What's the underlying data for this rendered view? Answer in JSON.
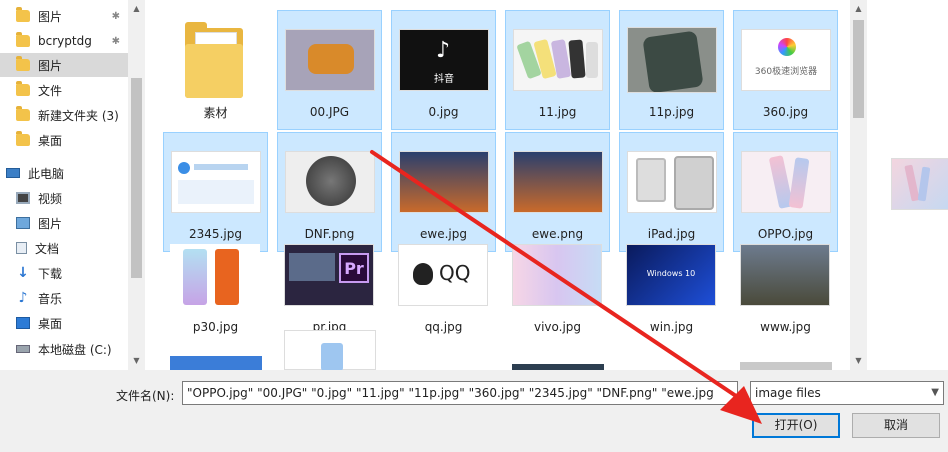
{
  "sidebar": {
    "items": [
      {
        "label": "图片",
        "pinned": true,
        "icon": "folder-icon"
      },
      {
        "label": "bcryptdg",
        "pinned": true,
        "icon": "folder-icon"
      },
      {
        "label": "图片",
        "pinned": false,
        "icon": "folder-icon"
      },
      {
        "label": "文件",
        "pinned": false,
        "icon": "folder-icon"
      },
      {
        "label": "新建文件夹 (3)",
        "pinned": false,
        "icon": "folder-icon"
      },
      {
        "label": "桌面",
        "pinned": false,
        "icon": "folder-icon"
      },
      {
        "label": "此电脑",
        "icon": "pc-icon"
      },
      {
        "label": "视频",
        "icon": "video-icon"
      },
      {
        "label": "图片",
        "icon": "picture-icon"
      },
      {
        "label": "文档",
        "icon": "document-icon"
      },
      {
        "label": "下载",
        "icon": "download-icon"
      },
      {
        "label": "音乐",
        "icon": "music-icon"
      },
      {
        "label": "桌面",
        "icon": "desktop-icon"
      },
      {
        "label": "本地磁盘 (C:)",
        "icon": "disk-icon"
      }
    ]
  },
  "files": [
    {
      "name": "素材",
      "type": "folder",
      "selected": false
    },
    {
      "name": "00.JPG",
      "type": "image",
      "selected": true,
      "thumb": "game-logo"
    },
    {
      "name": "0.jpg",
      "type": "image",
      "selected": true,
      "thumb": "tiktok",
      "thumb_text": "抖音"
    },
    {
      "name": "11.jpg",
      "type": "image",
      "selected": true,
      "thumb": "phones"
    },
    {
      "name": "11p.jpg",
      "type": "image",
      "selected": true,
      "thumb": "phone-dark"
    },
    {
      "name": "360.jpg",
      "type": "image",
      "selected": true,
      "thumb": "logo-360",
      "thumb_text": "360极速浏览器"
    },
    {
      "name": "2345.jpg",
      "type": "image",
      "selected": true,
      "thumb": "browser"
    },
    {
      "name": "DNF.png",
      "type": "image",
      "selected": true,
      "thumb": "dnf"
    },
    {
      "name": "ewe.jpg",
      "type": "image",
      "selected": true,
      "thumb": "battle"
    },
    {
      "name": "ewe.png",
      "type": "image",
      "selected": true,
      "thumb": "battle"
    },
    {
      "name": "iPad.jpg",
      "type": "image",
      "selected": true,
      "thumb": "ipad"
    },
    {
      "name": "OPPO.jpg",
      "type": "image",
      "selected": true,
      "thumb": "oppo"
    },
    {
      "name": "p30.jpg",
      "type": "image",
      "selected": false,
      "thumb": "p30"
    },
    {
      "name": "pr.jpg",
      "type": "image",
      "selected": false,
      "thumb": "premiere",
      "thumb_text": "Pr"
    },
    {
      "name": "qq.jpg",
      "type": "image",
      "selected": false,
      "thumb": "qq",
      "thumb_text": "QQ"
    },
    {
      "name": "vivo.jpg",
      "type": "image",
      "selected": false,
      "thumb": "vivo"
    },
    {
      "name": "win.jpg",
      "type": "image",
      "selected": false,
      "thumb": "windows",
      "thumb_text": "Windows 10"
    },
    {
      "name": "www.jpg",
      "type": "image",
      "selected": false,
      "thumb": "pubg"
    }
  ],
  "bottom": {
    "filename_label": "文件名(N):",
    "filename_value": "\"OPPO.jpg\" \"00.JPG\" \"0.jpg\" \"11.jpg\" \"11p.jpg\" \"360.jpg\" \"2345.jpg\" \"DNF.png\" \"ewe.jpg",
    "filetype_value": "image files",
    "open_label": "打开(O)",
    "cancel_label": "取消"
  },
  "colors": {
    "selection_bg": "#cce8ff",
    "selection_border": "#99d1ff",
    "arrow": "#e8251f",
    "open_border": "#0078d7"
  }
}
